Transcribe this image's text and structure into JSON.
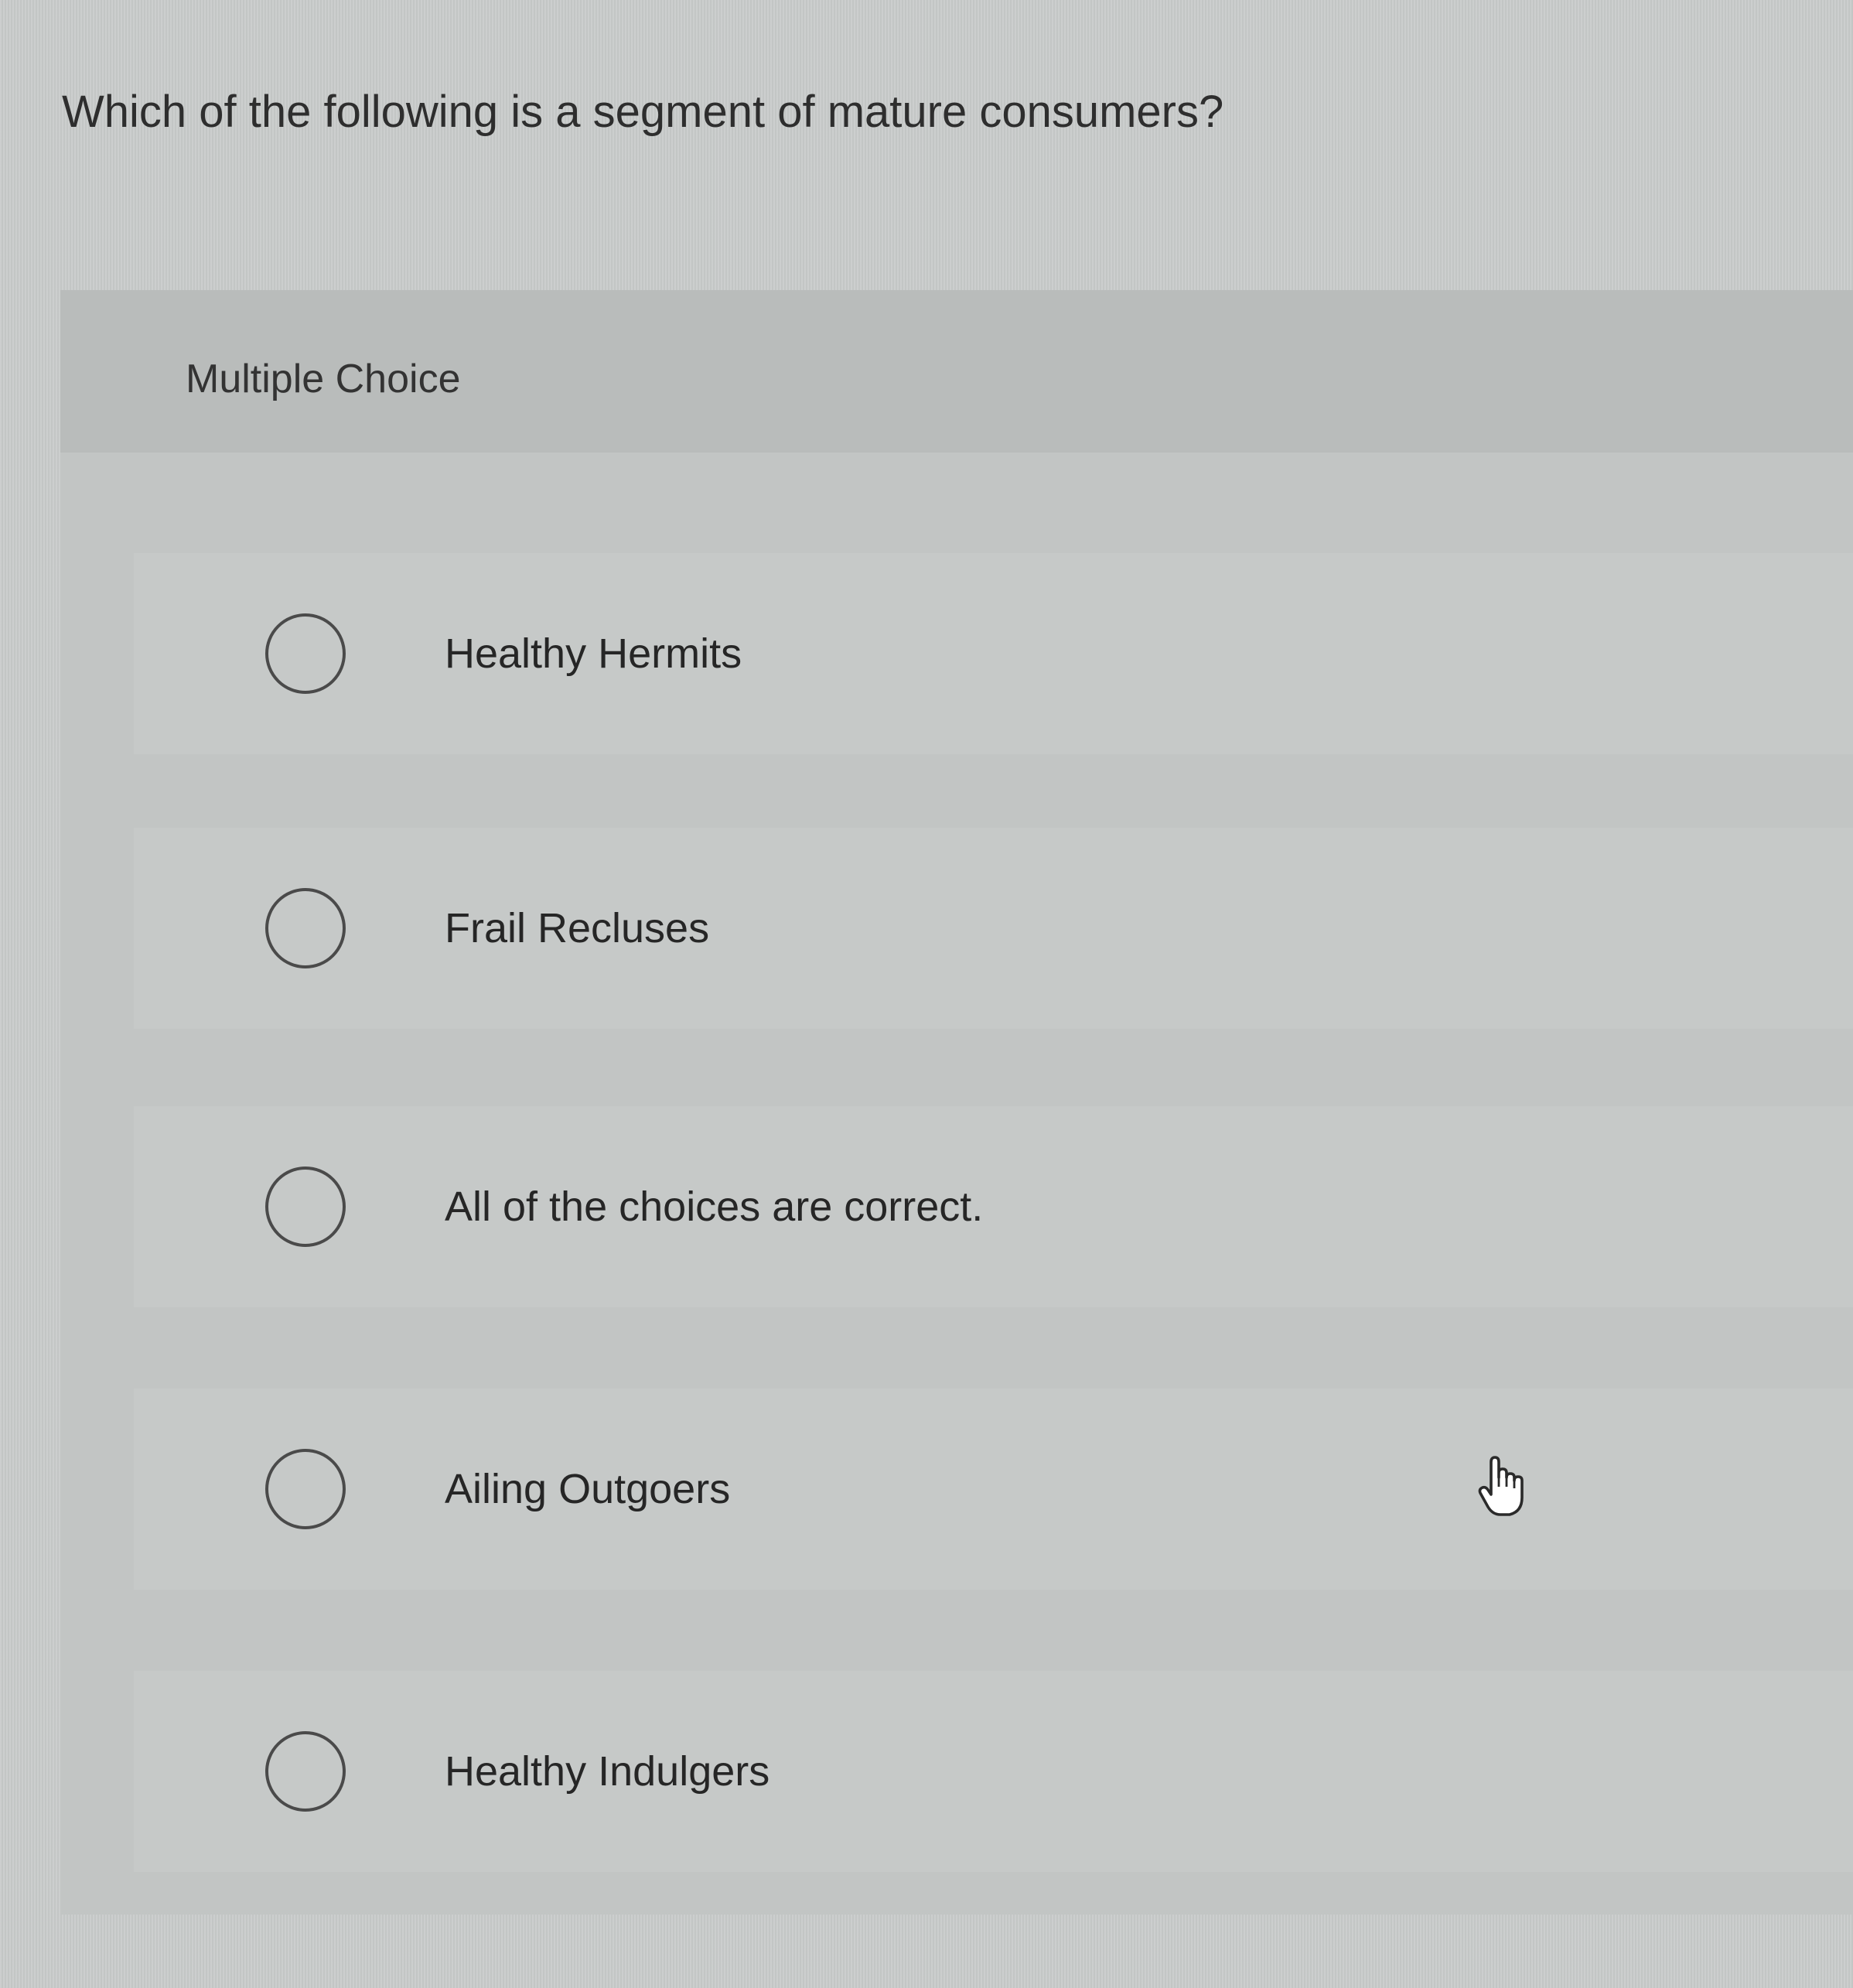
{
  "question": {
    "text": "Which of the following is a segment of mature consumers?"
  },
  "panel": {
    "label": "Multiple Choice"
  },
  "options": [
    {
      "label": "Healthy Hermits",
      "selected": false
    },
    {
      "label": "Frail Recluses",
      "selected": false
    },
    {
      "label": "All of the choices are correct.",
      "selected": false
    },
    {
      "label": "Ailing Outgoers",
      "selected": false
    },
    {
      "label": "Healthy Indulgers",
      "selected": false
    }
  ],
  "cursor": {
    "icon": "pointer-hand-icon"
  },
  "colors": {
    "background": "#c9cccb",
    "text": "#2b2b2b",
    "radio_border": "#4a4a4a"
  }
}
